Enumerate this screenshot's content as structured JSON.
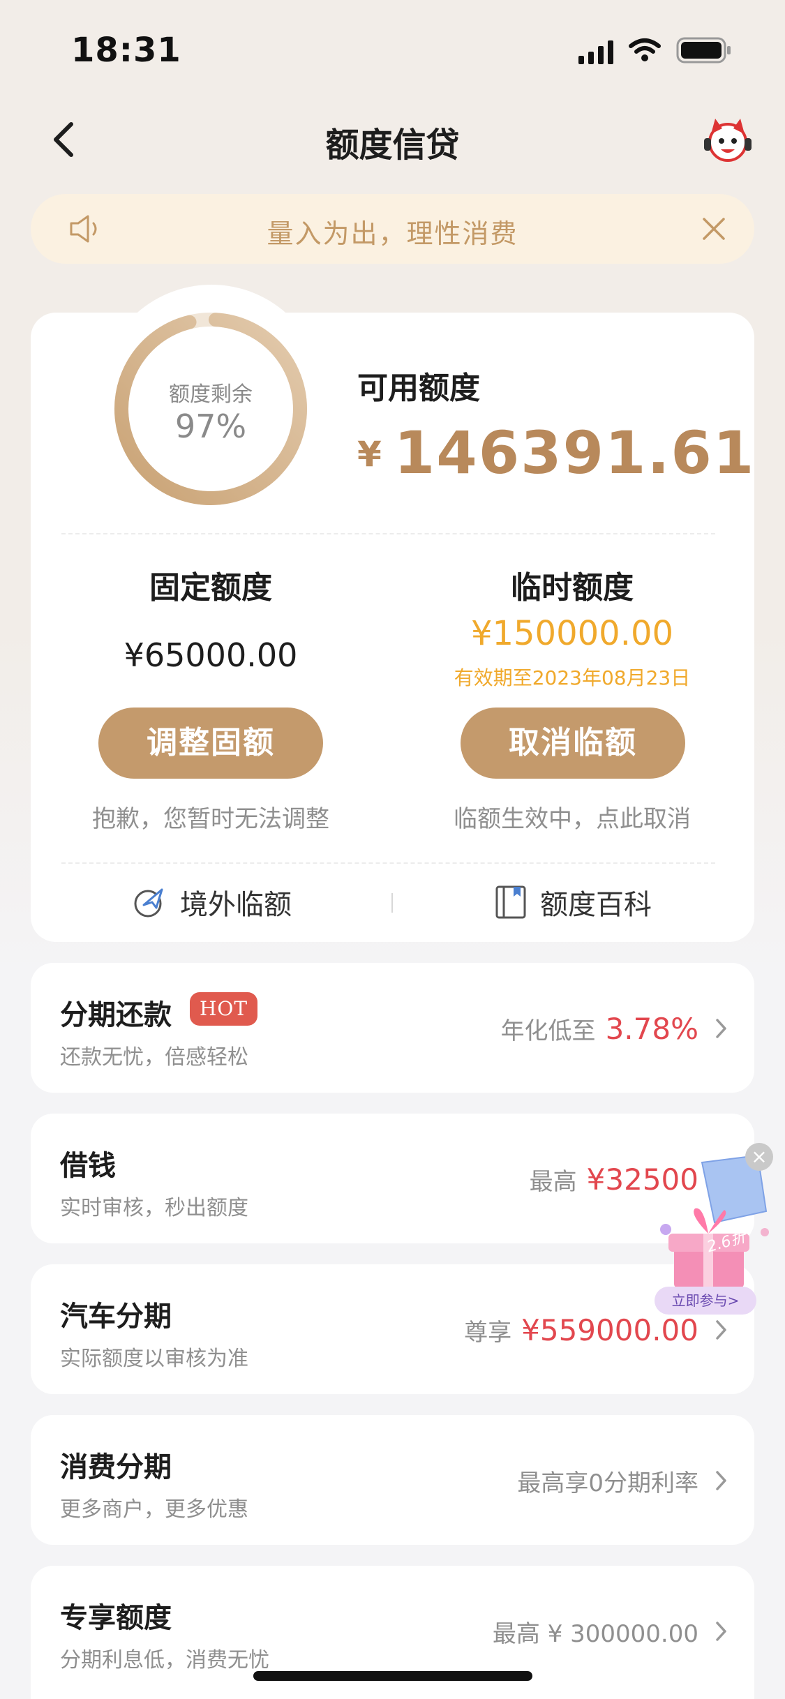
{
  "status_bar": {
    "time": "18:31"
  },
  "nav": {
    "title": "额度信贷"
  },
  "notice": {
    "text": "量入为出，理性消费"
  },
  "credit": {
    "ring_label": "额度剩余",
    "ring_value": "97%",
    "ring_fraction": 0.97,
    "available_label": "可用额度",
    "available_currency": "¥",
    "available_amount": "146391.61",
    "fixed": {
      "title": "固定额度",
      "amount": "¥65000.00",
      "button": "调整固额",
      "note": "抱歉，您暂时无法调整"
    },
    "temporary": {
      "title": "临时额度",
      "amount": "¥150000.00",
      "expiry": "有效期至2023年08月23日",
      "button": "取消临额",
      "note": "临额生效中，点此取消"
    },
    "links": {
      "overseas": "境外临额",
      "wiki": "额度百科"
    }
  },
  "products": [
    {
      "title": "分期还款",
      "badge": "HOT",
      "subtitle": "还款无忧，倍感轻松",
      "prefix": "年化低至",
      "highlight": "3.78%"
    },
    {
      "title": "借钱",
      "subtitle": "实时审核，秒出额度",
      "prefix": "最高",
      "highlight": "¥32500"
    },
    {
      "title": "汽车分期",
      "subtitle": "实际额度以审核为准",
      "prefix": "尊享",
      "highlight": "¥559000.00"
    },
    {
      "title": "消费分期",
      "subtitle": "更多商户，更多优惠",
      "plain": "最高享0分期利率"
    },
    {
      "title": "专享额度",
      "subtitle": "分期利息低，消费无忧",
      "plain": "最高 ¥ 300000.00"
    }
  ],
  "promo": {
    "discount": "2.6折",
    "cta": "立即参与>",
    "close": "×"
  },
  "colors": {
    "accent": "#c49a6c",
    "amount_gold": "#b8895b",
    "temp_orange": "#f0a92c",
    "highlight_red": "#e2474e"
  }
}
